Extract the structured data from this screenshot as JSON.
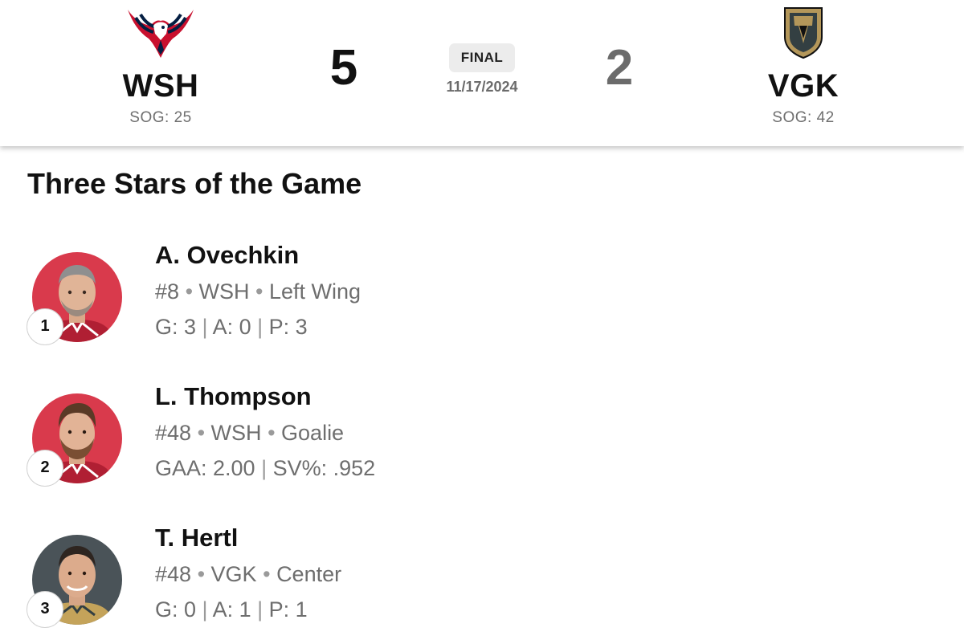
{
  "game": {
    "status": "FINAL",
    "date": "11/17/2024",
    "home": {
      "abbr": "WSH",
      "score": "5",
      "sog": "SOG: 25",
      "logo_icon": "capitals-eagle-logo",
      "colors": {
        "red": "#c8102e",
        "navy": "#041e42"
      }
    },
    "away": {
      "abbr": "VGK",
      "score": "2",
      "sog": "SOG: 42",
      "logo_icon": "golden-knights-helmet-logo",
      "colors": {
        "gold": "#b4975a",
        "steel": "#333f42"
      }
    }
  },
  "stars": {
    "title": "Three Stars of the Game",
    "players": [
      {
        "rank": "1",
        "name": "A. Ovechkin",
        "number": "#8",
        "team": "WSH",
        "position": "Left Wing",
        "stats": [
          "G: 3",
          "A: 0",
          "P: 3"
        ],
        "avatar_bg": "#d93a4c"
      },
      {
        "rank": "2",
        "name": "L. Thompson",
        "number": "#48",
        "team": "WSH",
        "position": "Goalie",
        "stats": [
          "GAA: 2.00",
          "SV%: .952"
        ],
        "avatar_bg": "#d93a4c"
      },
      {
        "rank": "3",
        "name": "T. Hertl",
        "number": "#48",
        "team": "VGK",
        "position": "Center",
        "stats": [
          "G: 0",
          "A: 1",
          "P: 1"
        ],
        "avatar_bg": "#4a5358"
      }
    ]
  }
}
